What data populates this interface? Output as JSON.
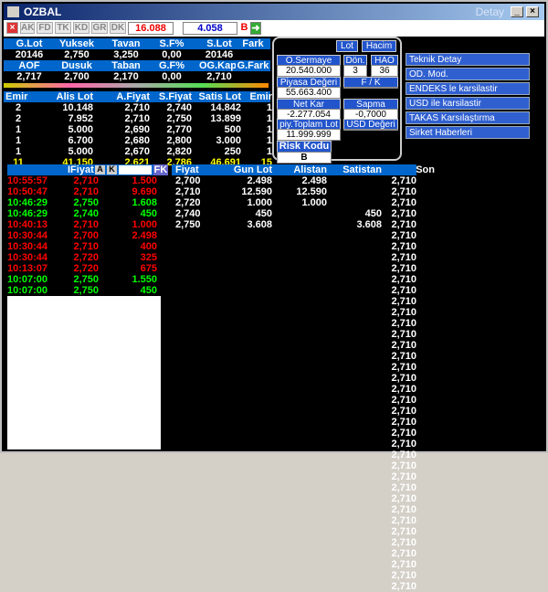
{
  "window": {
    "title": "OZBAL",
    "right_title": "Detay"
  },
  "toolbar": {
    "buttons": [
      "AK",
      "FD",
      "TK",
      "KD",
      "GR",
      "DK"
    ],
    "price": "16.088",
    "value2": "4.058",
    "b": "B"
  },
  "summary": {
    "h1": [
      "G.Lot",
      "Yuksek",
      "Tavan",
      "S.F%",
      "S.Lot",
      "Fark"
    ],
    "v1": [
      "20146",
      "2,750",
      "3,250",
      "0,00",
      "20146",
      ""
    ],
    "h2": [
      "AOF",
      "Dusuk",
      "Taban",
      "G.F%",
      "OG.Kap.",
      "G.Fark"
    ],
    "v2": [
      "2,717",
      "2,700",
      "2,170",
      "0,00",
      "2,710",
      ""
    ]
  },
  "depth": {
    "headers": [
      "Emir",
      "Alis Lot",
      "A.Fiyat",
      "S.Fiyat",
      "Satis Lot",
      "Emir"
    ],
    "rows": [
      [
        "2",
        "10.148",
        "2,710",
        "2,740",
        "14.842",
        "1"
      ],
      [
        "2",
        "7.952",
        "2,710",
        "2,750",
        "13.899",
        "1"
      ],
      [
        "1",
        "5.000",
        "2,690",
        "2,770",
        "500",
        "1"
      ],
      [
        "1",
        "6.700",
        "2,680",
        "2,800",
        "3.000",
        "1"
      ],
      [
        "1",
        "5.000",
        "2,670",
        "2,820",
        "250",
        "1"
      ]
    ],
    "total": [
      "11",
      "41.150",
      "2,621",
      "2,786",
      "46.691",
      "15"
    ]
  },
  "panel": {
    "btn_lot": "Lot",
    "btn_hacim": "Hacim",
    "o_sermaye": "O.Sermaye",
    "o_sermaye_val": "20.540.000",
    "don": "Dön.",
    "don_val": "3",
    "hao": "HAO",
    "hao_val": "36",
    "piyasa": "Piyasa Değeri",
    "piyasa_val": "55.663.400",
    "fk": "F / K",
    "fk_val": "",
    "netkar": "Net Kar",
    "netkar_val": "-2.277.054",
    "sapma": "Sapma",
    "sapma_val": "-0,7000",
    "toplam": "piy.Toplam Lot",
    "toplam_val": "11.999.999",
    "usd": "USD Değeri",
    "usd_val": "",
    "risk": "Risk Kodu",
    "risk_val": "B"
  },
  "menu": [
    "Teknik Detay",
    "OD. Mod.",
    "ENDEKS le karsilastir",
    "USD ile karsilastir",
    "TAKAS Karsılaştırma",
    "Sirket Haberleri"
  ],
  "trades": {
    "header": "IFiyat",
    "a": "A",
    "k": "K",
    "fk": "FK",
    "rows": [
      [
        "10:55:57",
        "2,710",
        "1.500",
        "r"
      ],
      [
        "10:50:47",
        "2,710",
        "9.690",
        "r"
      ],
      [
        "10:46:29",
        "2,750",
        "1.608",
        "g"
      ],
      [
        "10:46:29",
        "2,740",
        "450",
        "g"
      ],
      [
        "10:40:13",
        "2,710",
        "1.000",
        "r"
      ],
      [
        "10:30:44",
        "2,700",
        "2.498",
        "r"
      ],
      [
        "10:30:44",
        "2,710",
        "400",
        "r"
      ],
      [
        "10:30:44",
        "2,720",
        "325",
        "r"
      ],
      [
        "10:13:07",
        "2,720",
        "675",
        "r"
      ],
      [
        "10:07:00",
        "2,750",
        "1.550",
        "g"
      ],
      [
        "10:07:00",
        "2,750",
        "450",
        "g"
      ]
    ]
  },
  "book": {
    "headers": [
      "Fiyat",
      "Gun Lot",
      "Alistan",
      "Satistan",
      "Son"
    ],
    "rows": [
      [
        "2,700",
        "2.498",
        "2.498",
        ""
      ],
      [
        "2,710",
        "12.590",
        "12.590",
        ""
      ],
      [
        "2,720",
        "1.000",
        "1.000",
        ""
      ],
      [
        "2,740",
        "450",
        "",
        "450"
      ],
      [
        "2,750",
        "3.608",
        "",
        "3.608"
      ]
    ],
    "son": "2,710",
    "son_count": 38
  },
  "colors": {
    "header_blue": "#0066cc",
    "sell_red": "#ff0000",
    "buy_green": "#00ff00"
  }
}
